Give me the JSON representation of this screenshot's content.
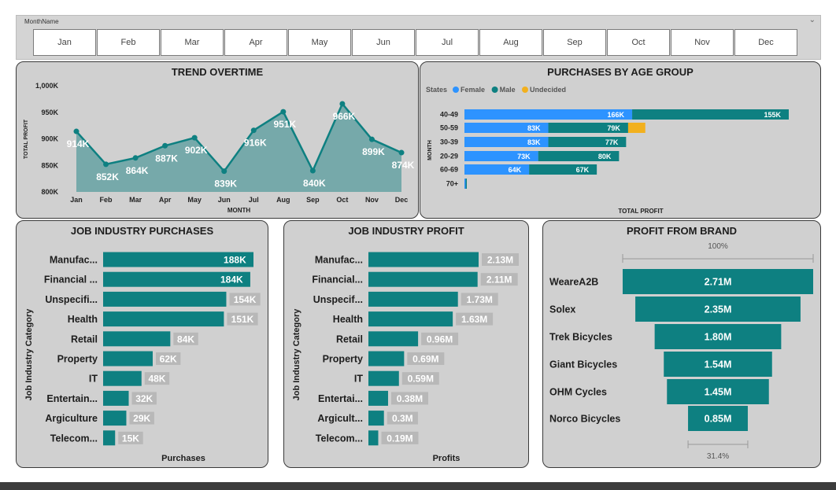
{
  "slicer": {
    "title": "MonthName",
    "months": [
      "Jan",
      "Feb",
      "Mar",
      "Apr",
      "May",
      "Jun",
      "Jul",
      "Aug",
      "Sep",
      "Oct",
      "Nov",
      "Dec"
    ]
  },
  "colors": {
    "teal": "#0e8081",
    "area": "#76a9aa",
    "female": "#2d93ff",
    "male": "#0e8081",
    "undecided": "#f2b01e",
    "label_box": "#b8b8b8",
    "panel_bg": "#d0d0d0"
  },
  "chart_data": [
    {
      "id": "trend",
      "type": "area",
      "title": "TREND OVERTIME",
      "xlabel": "MONTH",
      "ylabel": "TOTAL PROFIT",
      "categories": [
        "Jan",
        "Feb",
        "Mar",
        "Apr",
        "May",
        "Jun",
        "Jul",
        "Aug",
        "Sep",
        "Oct",
        "Nov",
        "Dec"
      ],
      "values": [
        914,
        852,
        864,
        887,
        902,
        839,
        916,
        951,
        840,
        966,
        899,
        874
      ],
      "data_labels": [
        "914K",
        "852K",
        "864K",
        "887K",
        "902K",
        "839K",
        "916K",
        "951K",
        "840K",
        "966K",
        "899K",
        "874K"
      ],
      "y_ticks": [
        "800K",
        "850K",
        "900K",
        "950K",
        "1,000K"
      ],
      "ylim": [
        800,
        1000
      ],
      "value_unit": "K"
    },
    {
      "id": "age",
      "type": "bar",
      "orientation": "horizontal-stacked",
      "title": "PURCHASES BY AGE GROUP",
      "legend_title": "States",
      "legend_position": "top-left",
      "xlabel": "TOTAL PROFIT",
      "ylabel": "MONTH",
      "categories": [
        "40-49",
        "50-59",
        "30-39",
        "20-29",
        "60-69",
        "70+"
      ],
      "series": [
        {
          "name": "Female",
          "values": [
            166,
            83,
            83,
            73,
            64,
            0.3
          ],
          "labels": [
            "166K",
            "83K",
            "83K",
            "73K",
            "64K",
            ""
          ]
        },
        {
          "name": "Male",
          "values": [
            155,
            79,
            77,
            80,
            67,
            0.5
          ],
          "labels": [
            "155K",
            "79K",
            "77K",
            "80K",
            "67K",
            ""
          ]
        },
        {
          "name": "Undecided",
          "values": [
            0,
            17,
            0,
            0,
            0,
            0
          ],
          "labels": [
            "",
            "",
            "",
            "",
            "",
            ""
          ]
        }
      ]
    },
    {
      "id": "industry_purchases",
      "type": "bar",
      "orientation": "horizontal",
      "title": "JOB INDUSTRY PURCHASES",
      "xlabel": "Purchases",
      "ylabel": "Job Industry Category",
      "categories": [
        "Manufac...",
        "Financial ...",
        "Unspecifi...",
        "Health",
        "Retail",
        "Property",
        "IT",
        "Entertain...",
        "Argiculture",
        "Telecom..."
      ],
      "values": [
        188,
        184,
        154,
        151,
        84,
        62,
        48,
        32,
        29,
        15
      ],
      "labels": [
        "188K",
        "184K",
        "154K",
        "151K",
        "84K",
        "62K",
        "48K",
        "32K",
        "29K",
        "15K"
      ]
    },
    {
      "id": "industry_profit",
      "type": "bar",
      "orientation": "horizontal",
      "title": "JOB INDUSTRY PROFIT",
      "xlabel": "Profits",
      "ylabel": "Job Industry Category",
      "categories": [
        "Manufac...",
        "Financial...",
        "Unspecif...",
        "Health",
        "Retail",
        "Property",
        "IT",
        "Entertai...",
        "Argicult...",
        "Telecom..."
      ],
      "values": [
        2.13,
        2.11,
        1.73,
        1.63,
        0.96,
        0.69,
        0.59,
        0.38,
        0.3,
        0.19
      ],
      "labels": [
        "2.13M",
        "2.11M",
        "1.73M",
        "1.63M",
        "0.96M",
        "0.69M",
        "0.59M",
        "0.38M",
        "0.3M",
        "0.19M"
      ]
    },
    {
      "id": "brand",
      "type": "bar",
      "orientation": "funnel",
      "title": "PROFIT FROM BRAND",
      "top_percent": "100%",
      "bottom_percent": "31.4%",
      "categories": [
        "WeareA2B",
        "Solex",
        "Trek Bicycles",
        "Giant Bicycles",
        "OHM Cycles",
        "Norco Bicycles"
      ],
      "values": [
        2.71,
        2.35,
        1.8,
        1.54,
        1.45,
        0.85
      ],
      "labels": [
        "2.71M",
        "2.35M",
        "1.80M",
        "1.54M",
        "1.45M",
        "0.85M"
      ]
    }
  ]
}
